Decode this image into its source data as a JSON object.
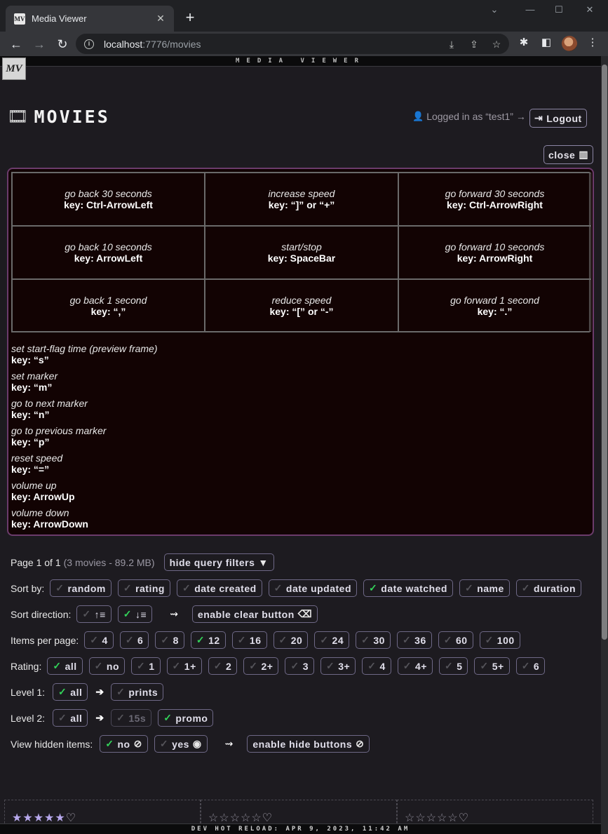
{
  "browser": {
    "tab_title": "Media Viewer",
    "favicon_text": "MV",
    "url_host": "localhost",
    "url_path": ":7776/movies"
  },
  "app": {
    "strip_title": "MEDIA VIEWER",
    "logo_text": "MV",
    "page_title": "MOVIES",
    "logged_in_text": "Logged in as “test1” →",
    "logout_label": "Logout",
    "close_label": "close"
  },
  "keys": {
    "grid": [
      {
        "desc": "go back 30 seconds",
        "key": "key: Ctrl-ArrowLeft"
      },
      {
        "desc": "increase speed",
        "key": "key: “]” or “+”"
      },
      {
        "desc": "go forward 30 seconds",
        "key": "key: Ctrl-ArrowRight"
      },
      {
        "desc": "go back 10 seconds",
        "key": "key: ArrowLeft"
      },
      {
        "desc": "start/stop",
        "key": "key: SpaceBar"
      },
      {
        "desc": "go forward 10 seconds",
        "key": "key: ArrowRight"
      },
      {
        "desc": "go back 1 second",
        "key": "key: “,”"
      },
      {
        "desc": "reduce speed",
        "key": "key: “[” or “-”"
      },
      {
        "desc": "go forward 1 second",
        "key": "key: “.”"
      }
    ],
    "list": [
      {
        "desc": "set start-flag time (preview frame)",
        "key": "key: “s”"
      },
      {
        "desc": "set marker",
        "key": "key: “m”"
      },
      {
        "desc": "go to next marker",
        "key": "key: “n”"
      },
      {
        "desc": "go to previous marker",
        "key": "key: “p”"
      },
      {
        "desc": "reset speed",
        "key": "key: “=”"
      },
      {
        "desc": "volume up",
        "key": "key: ArrowUp"
      },
      {
        "desc": "volume down",
        "key": "key: ArrowDown"
      }
    ]
  },
  "filters": {
    "page_text": "Page 1 of 1",
    "count_text": "(3 movies - 89.2 MB)",
    "hide_filters_label": "hide query filters",
    "sort_label": "Sort by:",
    "sort_options": [
      {
        "label": "random",
        "on": false
      },
      {
        "label": "rating",
        "on": false
      },
      {
        "label": "date created",
        "on": false
      },
      {
        "label": "date updated",
        "on": false
      },
      {
        "label": "date watched",
        "on": true
      },
      {
        "label": "name",
        "on": false
      },
      {
        "label": "duration",
        "on": false
      }
    ],
    "direction_label": "Sort direction:",
    "enable_clear_label": "enable clear button",
    "items_label": "Items per page:",
    "items_options": [
      {
        "label": "4",
        "on": false
      },
      {
        "label": "6",
        "on": false
      },
      {
        "label": "8",
        "on": false
      },
      {
        "label": "12",
        "on": true
      },
      {
        "label": "16",
        "on": false
      },
      {
        "label": "20",
        "on": false
      },
      {
        "label": "24",
        "on": false
      },
      {
        "label": "30",
        "on": false
      },
      {
        "label": "36",
        "on": false
      },
      {
        "label": "60",
        "on": false
      },
      {
        "label": "100",
        "on": false
      }
    ],
    "rating_label": "Rating:",
    "rating_options": [
      {
        "label": "all",
        "on": true
      },
      {
        "label": "no",
        "on": false
      },
      {
        "label": "1",
        "on": false
      },
      {
        "label": "1+",
        "on": false
      },
      {
        "label": "2",
        "on": false
      },
      {
        "label": "2+",
        "on": false
      },
      {
        "label": "3",
        "on": false
      },
      {
        "label": "3+",
        "on": false
      },
      {
        "label": "4",
        "on": false
      },
      {
        "label": "4+",
        "on": false
      },
      {
        "label": "5",
        "on": false
      },
      {
        "label": "5+",
        "on": false
      },
      {
        "label": "6",
        "on": false
      }
    ],
    "level1_label": "Level 1:",
    "level1_all": "all",
    "level1_next": "prints",
    "level2_label": "Level 2:",
    "level2_all": "all",
    "level2_15s": "15s",
    "level2_promo": "promo",
    "hidden_label": "View hidden items:",
    "hidden_no": "no",
    "hidden_yes": "yes",
    "enable_hide_label": "enable hide buttons"
  },
  "cards": [
    {
      "rating": 5
    },
    {
      "rating": 0
    },
    {
      "rating": 0
    }
  ],
  "footer": {
    "hot_reload": "DEV HOT RELOAD: APR 9, 2023, 11:42 AM"
  },
  "colors": {
    "accent_check": "#33d45a",
    "panel_border": "#6b3b6b",
    "star_on": "#b7a8ec"
  }
}
